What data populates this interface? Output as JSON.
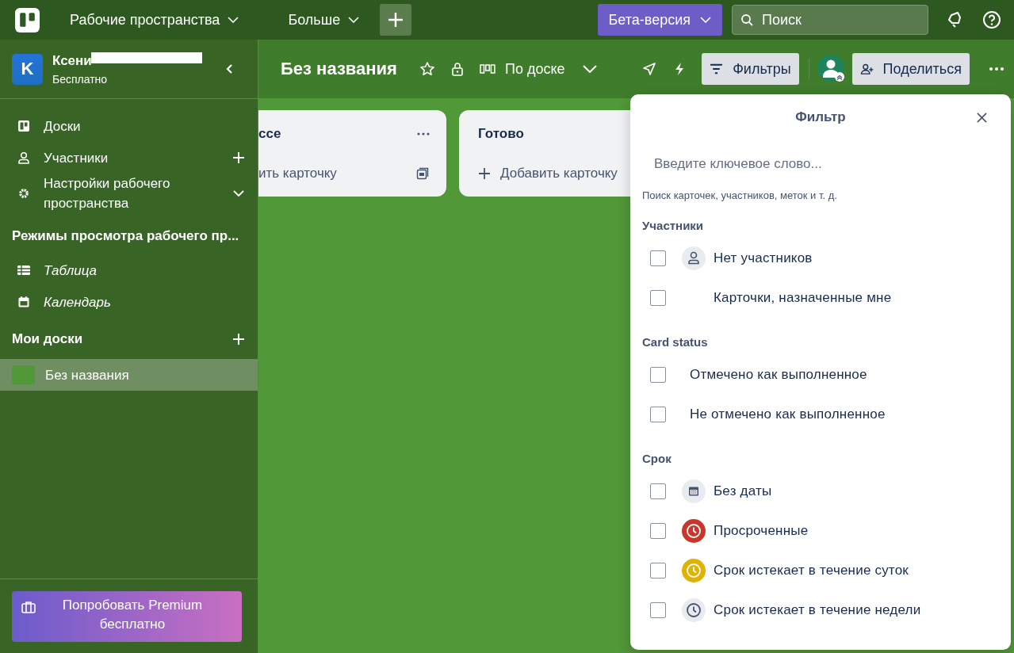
{
  "top_bar": {
    "workspaces_menu": "Рабочие пространства",
    "more_menu": "Больше",
    "beta_button": "Бета-версия",
    "search": {
      "placeholder": "Поиск"
    }
  },
  "sidebar": {
    "workspace": {
      "initial": "K",
      "name": "Ксени",
      "plan": "Бесплатно"
    },
    "nav": [
      {
        "kind": "boards",
        "label": "Доски"
      },
      {
        "kind": "members",
        "label": "Участники"
      },
      {
        "kind": "settings",
        "label": "Настройки рабочего пространства"
      }
    ],
    "views_heading": "Режимы просмотра рабочего пр...",
    "views": [
      {
        "kind": "table",
        "label": "Таблица"
      },
      {
        "kind": "calendar",
        "label": "Календарь"
      }
    ],
    "boards_heading": "Мои доски",
    "boards": [
      {
        "label": "Без названия",
        "selected": true
      }
    ],
    "premium_button": "Попробовать Premium бесплатно"
  },
  "board": {
    "title": "Без названия",
    "view_switch": "По доске",
    "filters_button": "Фильтры",
    "share_button": "Поделиться",
    "lists": [
      {
        "title": "ссе",
        "add_card": "ить карточку",
        "clipped": true
      },
      {
        "title": "Готово",
        "add_card": "Добавить карточку",
        "clipped": false
      }
    ]
  },
  "filter_panel": {
    "title": "Фильтр",
    "search": {
      "placeholder": "Введите ключевое слово..."
    },
    "hint": "Поиск карточек, участников, меток и т. д.",
    "sections": [
      {
        "heading": "Участники",
        "items": [
          {
            "kind": "person",
            "label": "Нет участников",
            "checked": false
          },
          {
            "kind": "blank",
            "label": "Карточки, назначенные мне",
            "checked": false
          }
        ]
      },
      {
        "heading": "Card status",
        "items": [
          {
            "kind": "plain",
            "label": "Отмечено как выполненное",
            "checked": false
          },
          {
            "kind": "plain",
            "label": "Не отмечено как выполненное",
            "checked": false
          }
        ]
      },
      {
        "heading": "Срок",
        "items": [
          {
            "kind": "calendar",
            "label": "Без даты",
            "checked": false
          },
          {
            "kind": "clock",
            "color": "#c9372c",
            "label": "Просроченные",
            "checked": false
          },
          {
            "kind": "clock",
            "color": "#e2b203",
            "label": "Срок истекает в течение суток",
            "checked": false
          },
          {
            "kind": "clock",
            "color": "#e9ebee",
            "label": "Срок истекает в течение недели",
            "checked": false
          }
        ]
      }
    ]
  }
}
